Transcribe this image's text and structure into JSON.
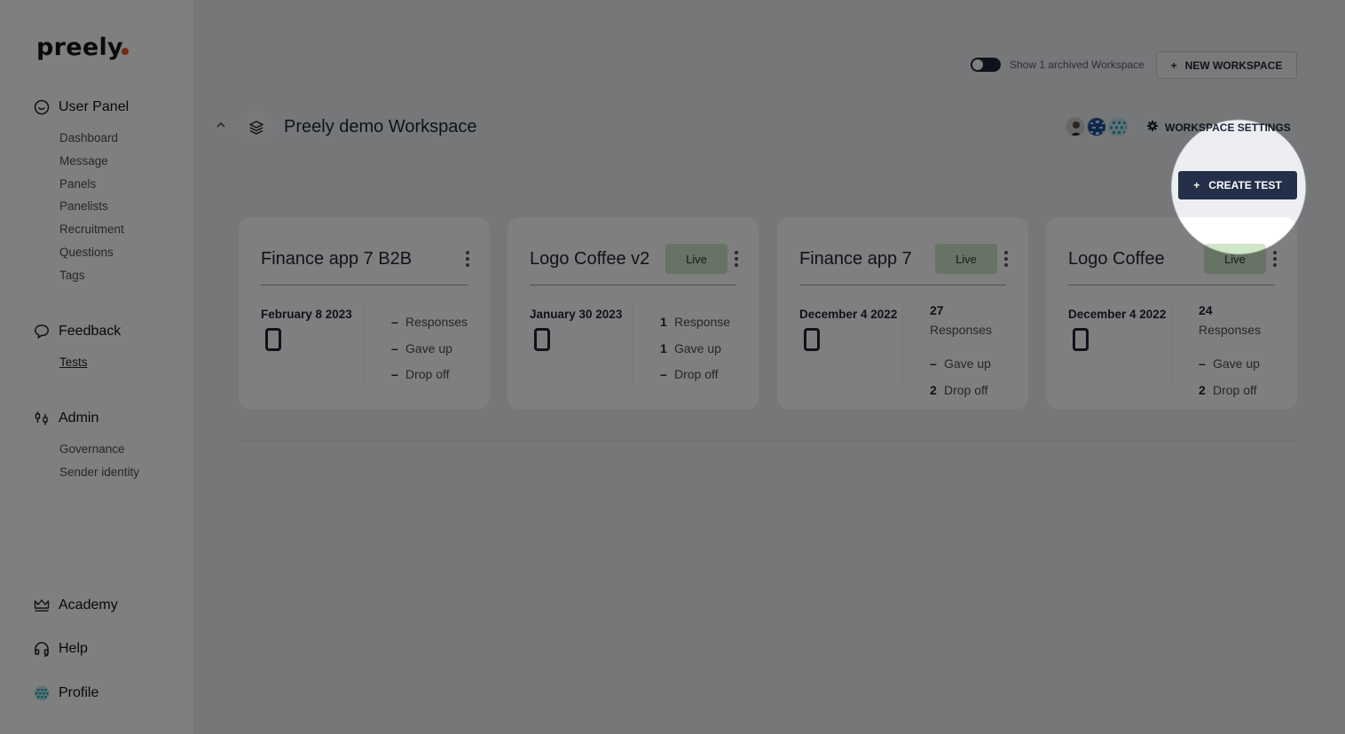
{
  "brand": {
    "name": "preely",
    "accent": "#e8532b"
  },
  "sidebar": {
    "sections": [
      {
        "label": "User Panel",
        "icon": "smile-icon",
        "items": [
          "Dashboard",
          "Message",
          "Panels",
          "Panelists",
          "Recruitment",
          "Questions",
          "Tags"
        ]
      },
      {
        "label": "Feedback",
        "icon": "chat-bubble-icon",
        "items": [
          "Tests"
        ],
        "active": "Tests"
      },
      {
        "label": "Admin",
        "icon": "sliders-icon",
        "items": [
          "Governance",
          "Sender identity"
        ]
      }
    ],
    "bottom": [
      {
        "label": "Academy",
        "icon": "crown-icon"
      },
      {
        "label": "Help",
        "icon": "headset-icon"
      },
      {
        "label": "Profile",
        "icon": "globe-avatar-icon"
      }
    ]
  },
  "toolbar": {
    "archived_toggle_label": "Show 1 archived Workspace",
    "archived_toggle_on": false,
    "new_workspace_label": "NEW WORKSPACE"
  },
  "workspace": {
    "title": "Preely demo Workspace",
    "settings_label": "WORKSPACE SETTINGS",
    "create_test_label": "CREATE TEST",
    "member_avatars": 3
  },
  "tests": [
    {
      "title": "Finance app 7 B2B",
      "status": "",
      "date": "February 8 2023",
      "device": "mobile",
      "responses": {
        "num": "–",
        "label": "Responses"
      },
      "gave_up": {
        "num": "–",
        "label": "Gave up"
      },
      "drop_off": {
        "num": "–",
        "label": "Drop off"
      }
    },
    {
      "title": "Logo Coffee v2",
      "status": "Live",
      "date": "January 30 2023",
      "device": "mobile",
      "responses": {
        "num": "1",
        "label": "Response"
      },
      "gave_up": {
        "num": "1",
        "label": "Gave up"
      },
      "drop_off": {
        "num": "–",
        "label": "Drop off"
      }
    },
    {
      "title": "Finance app 7",
      "status": "Live",
      "date": "December 4 2022",
      "device": "mobile",
      "responses": {
        "num": "27",
        "label": "Responses"
      },
      "gave_up": {
        "num": "–",
        "label": "Gave up"
      },
      "drop_off": {
        "num": "2",
        "label": "Drop off"
      }
    },
    {
      "title": "Logo Coffee",
      "status": "Live",
      "date": "December 4 2022",
      "device": "mobile",
      "responses": {
        "num": "24",
        "label": "Responses"
      },
      "gave_up": {
        "num": "–",
        "label": "Gave up"
      },
      "drop_off": {
        "num": "2",
        "label": "Drop off"
      }
    }
  ],
  "spotlight": {
    "target": "create-test-button"
  }
}
